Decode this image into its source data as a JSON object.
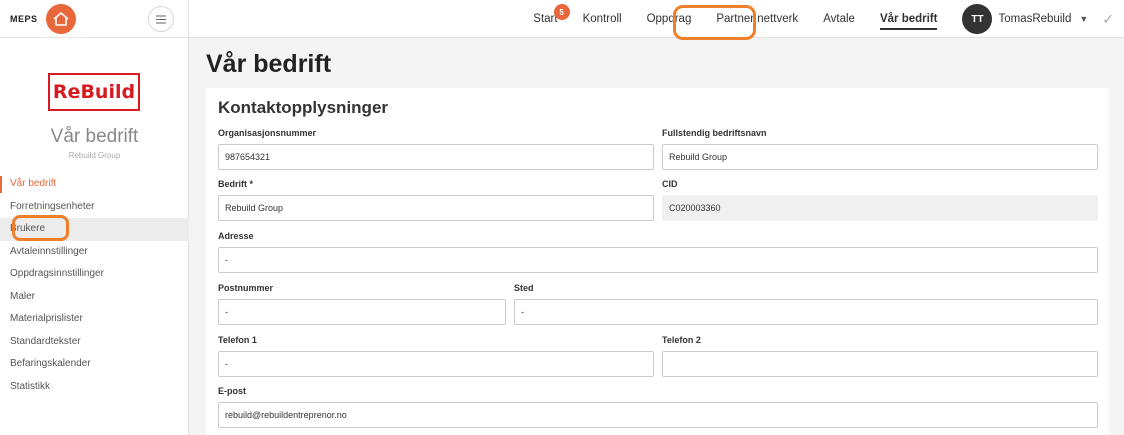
{
  "brand": {
    "name": "MEPS"
  },
  "company": {
    "logo_text": "ReBuild",
    "name": "Vår bedrift",
    "sub": "Rebuild Group"
  },
  "sidebar": {
    "items": [
      {
        "label": "Vår bedrift"
      },
      {
        "label": "Forretningsenheter"
      },
      {
        "label": "Brukere"
      },
      {
        "label": "Avtaleinnstillinger"
      },
      {
        "label": "Oppdragsinnstillinger"
      },
      {
        "label": "Maler"
      },
      {
        "label": "Materialprislister"
      },
      {
        "label": "Standardtekster"
      },
      {
        "label": "Befaringskalender"
      },
      {
        "label": "Statistikk"
      }
    ]
  },
  "topnav": {
    "items": [
      {
        "label": "Start",
        "badge": "5"
      },
      {
        "label": "Kontroll"
      },
      {
        "label": "Oppdrag"
      },
      {
        "label": "Partner nettverk"
      },
      {
        "label": "Avtale"
      },
      {
        "label": "Vår bedrift"
      }
    ],
    "user_initials": "TT",
    "user_name": "TomasRebuild"
  },
  "page": {
    "title": "Vår bedrift"
  },
  "contact": {
    "title": "Kontaktopplysninger",
    "org_label": "Organisasjonsnummer",
    "org_value": "987654321",
    "fullname_label": "Fullstendig bedriftsnavn",
    "fullname_value": "Rebuild Group",
    "company_label": "Bedrift *",
    "company_value": "Rebuild Group",
    "cid_label": "CID",
    "cid_value": "C020003360",
    "address_label": "Adresse",
    "address_value": "-",
    "postnr_label": "Postnummer",
    "postnr_value": "-",
    "city_label": "Sted",
    "city_value": "-",
    "phone1_label": "Telefon 1",
    "phone1_value": "-",
    "phone2_label": "Telefon 2",
    "phone2_value": "",
    "email_label": "E-post",
    "email_value": "rebuild@rebuildentreprenor.no"
  },
  "colors": {
    "accent": "#e9683b",
    "highlight": "#f07f2c",
    "logo_red": "#d71920"
  }
}
